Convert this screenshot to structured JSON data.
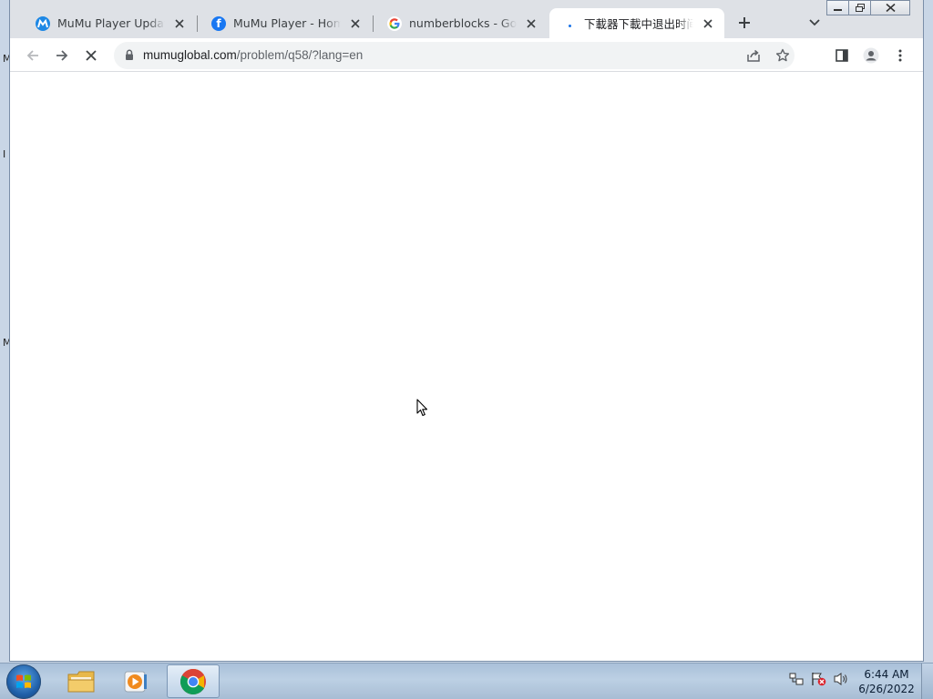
{
  "desktop": {
    "edge_letters": [
      "M",
      "I",
      "M"
    ]
  },
  "browser": {
    "tabs": [
      {
        "title": "MuMu Player Update Notes",
        "favicon": "mumu-logo-icon",
        "active": false
      },
      {
        "title": "MuMu Player - Home | Facebook",
        "favicon": "facebook-icon",
        "active": false
      },
      {
        "title": "numberblocks - Google Search",
        "favicon": "google-icon",
        "active": false
      },
      {
        "title": "下載器下載中退出时间等",
        "favicon": "loading-icon",
        "active": true
      }
    ],
    "address": {
      "host": "mumuglobal.com",
      "path": "/problem/q58/?lang=en"
    },
    "accent_color": "#1a73e8"
  },
  "taskbar": {
    "apps": [
      {
        "name": "Windows Explorer",
        "icon": "folder-icon",
        "active": false
      },
      {
        "name": "Windows Media Player",
        "icon": "media-player-icon",
        "active": false
      },
      {
        "name": "Google Chrome",
        "icon": "chrome-icon",
        "active": true
      }
    ],
    "clock": {
      "time": "6:44 AM",
      "date": "6/26/2022"
    }
  }
}
